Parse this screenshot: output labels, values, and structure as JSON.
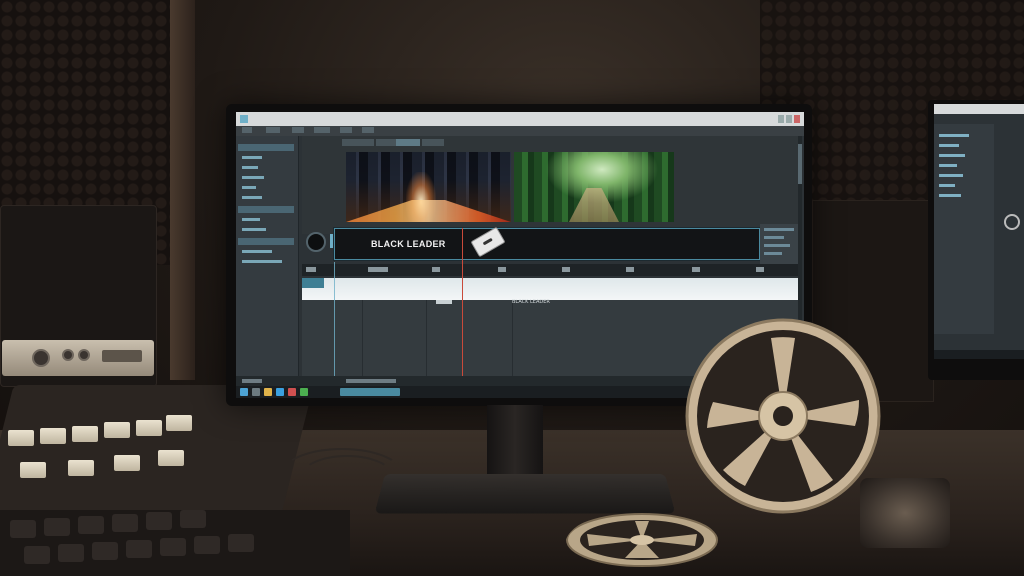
{
  "scene": {
    "description_colors": {
      "accent": "#6fb0c8",
      "playhead": "#c94a3a",
      "reel": "#c8b497"
    }
  },
  "editor": {
    "title_text": "",
    "menu": [
      "",
      "",
      "",
      "",
      "",
      "",
      "",
      "",
      "",
      ""
    ],
    "timeline_clip_label": "BLACK LEADER",
    "track_clip_label": "BLACK LEADER"
  }
}
